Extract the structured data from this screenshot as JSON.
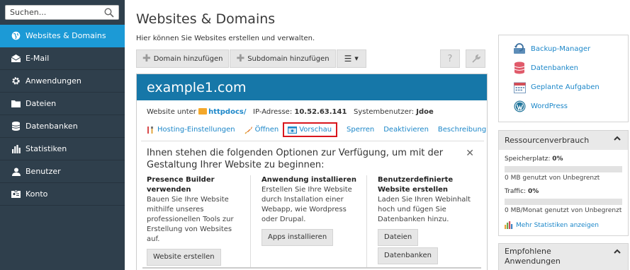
{
  "sidebar": {
    "search_placeholder": "Suchen...",
    "items": [
      {
        "label": "Websites & Domains",
        "active": true
      },
      {
        "label": "E-Mail"
      },
      {
        "label": "Anwendungen"
      },
      {
        "label": "Dateien"
      },
      {
        "label": "Datenbanken"
      },
      {
        "label": "Statistiken"
      },
      {
        "label": "Benutzer"
      },
      {
        "label": "Konto"
      }
    ]
  },
  "main": {
    "title": "Websites & Domains",
    "description": "Hier können Sie Websites erstellen und verwalten.",
    "toolbar": {
      "add_domain": "Domain hinzufügen",
      "add_subdomain": "Subdomain hinzufügen"
    },
    "domain": {
      "name": "example1.com",
      "website_prefix": "Website unter",
      "docroot": "httpdocs/",
      "ip_label": "IP-Adresse:",
      "ip": "10.52.63.141",
      "sysuser_label": "Systembenutzer:",
      "sysuser": "Jdoe",
      "actions": {
        "hosting": "Hosting-Einstellungen",
        "open": "Öffnen",
        "preview": "Vorschau",
        "suspend": "Sperren",
        "deactivate": "Deaktivieren",
        "description": "Beschreibung"
      }
    },
    "options": {
      "title": "Ihnen stehen die folgenden Optionen zur Verfügung, um mit der Gestaltung Ihrer Website zu beginnen:",
      "presence": {
        "title": "Presence Builder verwenden",
        "text": "Bauen Sie Ihre Website mithilfe unseres professionellen Tools zur Erstellung von Websites auf.",
        "button": "Website erstellen"
      },
      "install": {
        "title": "Anwendung installieren",
        "text": "Erstellen Sie Ihre Website durch Installation einer Webapp, wie Wordpress oder Drupal.",
        "button": "Apps installieren"
      },
      "custom": {
        "title": "Benutzerdefinierte Website erstellen",
        "text": "Laden Sie Ihren Webinhalt hoch und fügen Sie Datenbanken hinzu.",
        "button_files": "Dateien",
        "button_db": "Datenbanken"
      }
    }
  },
  "right": {
    "links": {
      "backup": "Backup-Manager",
      "databases": "Datenbanken",
      "scheduled": "Geplante Aufgaben",
      "wordpress": "WordPress"
    },
    "resources": {
      "title": "Ressourcenverbrauch",
      "storage_label": "Speicherplatz:",
      "storage_value": "0%",
      "storage_sub": "0 MB genutzt von Unbegrenzt",
      "traffic_label": "Traffic:",
      "traffic_value": "0%",
      "traffic_sub": "0 MB/Monat genutzt von Unbegrenzt",
      "more": "Mehr Statistiken anzeigen"
    },
    "recommended": {
      "title": "Empfohlene Anwendungen"
    }
  },
  "colors": {
    "sidebar_bg": "#2f3f4c",
    "active": "#1c9ad6",
    "domain_header": "#1677a8",
    "link": "#1c87c9",
    "highlight_border": "#d9161d"
  }
}
